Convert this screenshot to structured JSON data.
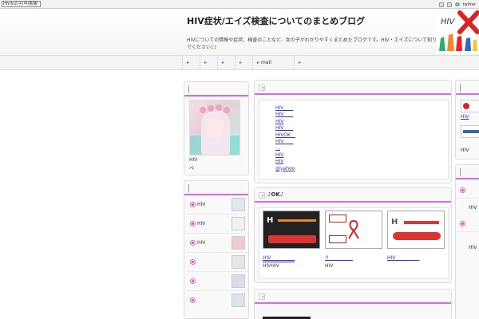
{
  "topbar": {
    "left_label": "HIV女の子(中)新版!",
    "right_twitter": "twitter"
  },
  "header": {
    "title": "HIV症状/エイズ検査についてのまとめブログ",
    "description": "HIVについての情報や症状、検査のことなど、女の子がわかりやすくまとめたブログです。HIV・エイズについて知りたい方はぜひ読んでください♪♪"
  },
  "nav": {
    "mail": "mail"
  },
  "profile": {
    "name": "HIV",
    "sub": "ペ"
  },
  "side_list": [
    "HIV",
    "HIV",
    "HIV",
    "",
    "",
    ""
  ],
  "center_links": [
    "HIV　　",
    "HIV　　",
    "HIV",
    "HIV　　",
    "HIVOK　",
    "HIV　　",
    "…",
    "HIV",
    "HIV",
    "@yahoo"
  ],
  "ok_section": {
    "title": "♪OK♪",
    "cards": [
      {
        "caption": "HIV　　　　　",
        "sub": "HIVHIV"
      },
      {
        "caption": "!!　　　　　",
        "sub": "HIV"
      },
      {
        "caption": "HIV　　　　　",
        "sub": ""
      }
    ]
  },
  "right_col": {
    "link": "HIV",
    "text1": "HIV",
    "text2": "HIV",
    "text3": "HIV"
  },
  "colors": {
    "accent": "#dd66ee",
    "link": "#3333cc",
    "panel": "#f9f9f9"
  }
}
